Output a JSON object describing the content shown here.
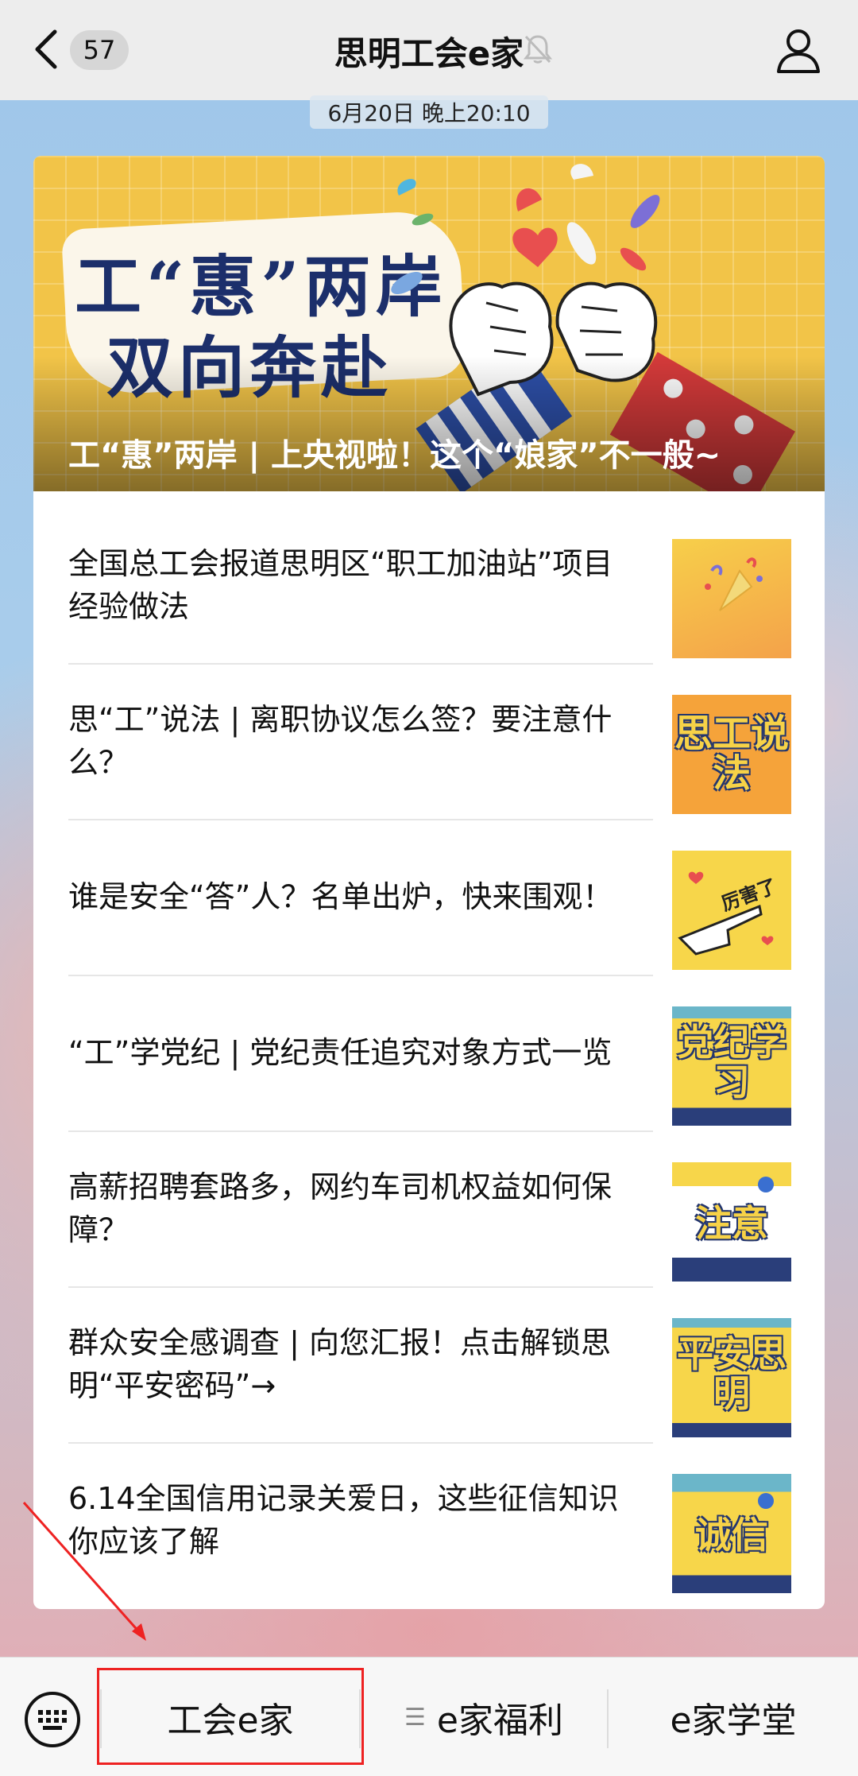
{
  "header": {
    "unread_count": "57",
    "title": "思明工会e家"
  },
  "timestamp": "6月20日 晚上20:10",
  "hero": {
    "art_line1": "工“惠”两岸",
    "art_line2": "双向奔赴",
    "caption": "工“惠”两岸 | 上央视啦！这个“娘家”不一般~"
  },
  "articles": [
    {
      "title": "全国总工会报道思明区“职工加油站”项目经验做法",
      "thumb_text": ""
    },
    {
      "title": "思“工”说法 | 离职协议怎么签？要注意什么？",
      "thumb_text": "思工说法"
    },
    {
      "title": "谁是安全“答”人？名单出炉，快来围观！",
      "thumb_text": "厉害了"
    },
    {
      "title": "“工”学党纪 | 党纪责任追究对象方式一览",
      "thumb_text": "党纪学习"
    },
    {
      "title": "高薪招聘套路多，网约车司机权益如何保障？",
      "thumb_text": "注意"
    },
    {
      "title": "群众安全感调查 | 向您汇报！点击解锁思明“平安密码”→",
      "thumb_text": "平安思明"
    },
    {
      "title": "6.14全国信用记录关爱日，这些征信知识你应该了解",
      "thumb_text": "诚信"
    }
  ],
  "menu": {
    "items": [
      "工会e家",
      "e家福利",
      "e家学堂"
    ]
  },
  "colors": {
    "annotation": "#ee2222",
    "hero_yellow": "#f2c448",
    "thumb_navy": "#24366e"
  }
}
